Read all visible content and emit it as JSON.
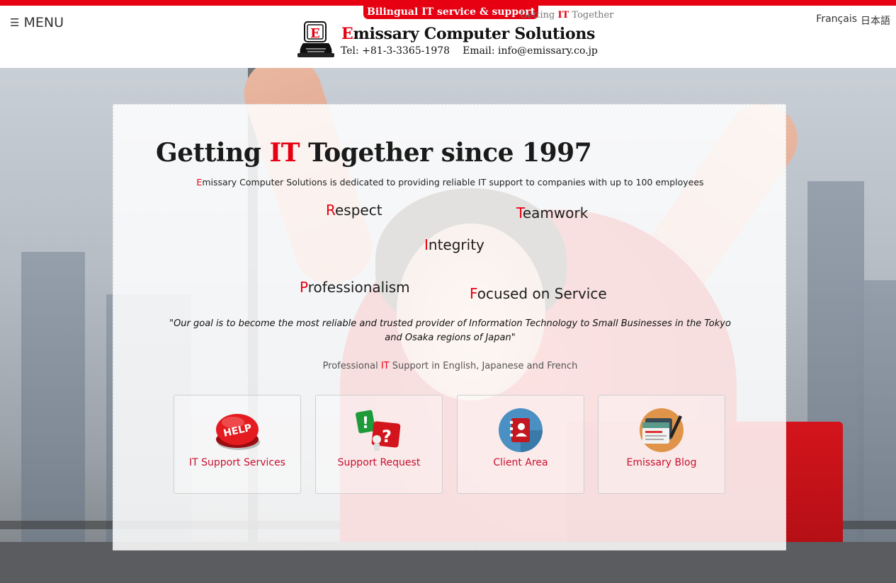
{
  "header": {
    "menu_label": "MENU",
    "badge": "Bilingual IT service & support",
    "tagline": {
      "pre": "Getting ",
      "red": "IT",
      "post": " Together"
    },
    "company": {
      "first_letter": "E",
      "rest": "missary Computer Solutions"
    },
    "tel": "Tel: +81-3-3365-1978",
    "email": "Email: info@emissary.co.jp",
    "languages": [
      "Français",
      "日本語"
    ],
    "logo_letter": "E"
  },
  "hero": {
    "headline": {
      "pre": "Getting ",
      "red": "IT",
      "post": " Together since 1997"
    },
    "intro": {
      "first_letter": "E",
      "rest": "missary Computer Solutions is dedicated to providing reliable IT support to companies with up to 100 employees"
    },
    "values": [
      {
        "first": "R",
        "rest": "espect"
      },
      {
        "first": "T",
        "rest": "eamwork"
      },
      {
        "first": "I",
        "rest": "ntegrity"
      },
      {
        "first": "P",
        "rest": "rofessionalism"
      },
      {
        "first": "F",
        "rest": "ocused on Service"
      }
    ],
    "quote": "\"Our goal is to become the most reliable and trusted provider of Information Technology to Small Businesses in the Tokyo and Osaka regions of Japan\"",
    "sub": {
      "pre": "Professional ",
      "red": "IT",
      "post": " Support in English, Japanese and French"
    }
  },
  "tiles": [
    {
      "label": "IT Support Services",
      "icon": "help-button-icon",
      "icon_text": "HELP"
    },
    {
      "label": "Support Request",
      "icon": "question-exclamation-icon"
    },
    {
      "label": "Client Area",
      "icon": "address-book-icon"
    },
    {
      "label": "Emissary Blog",
      "icon": "blog-pen-icon"
    }
  ],
  "colors": {
    "brand_red": "#e60012",
    "tile_label": "#c8102e"
  }
}
